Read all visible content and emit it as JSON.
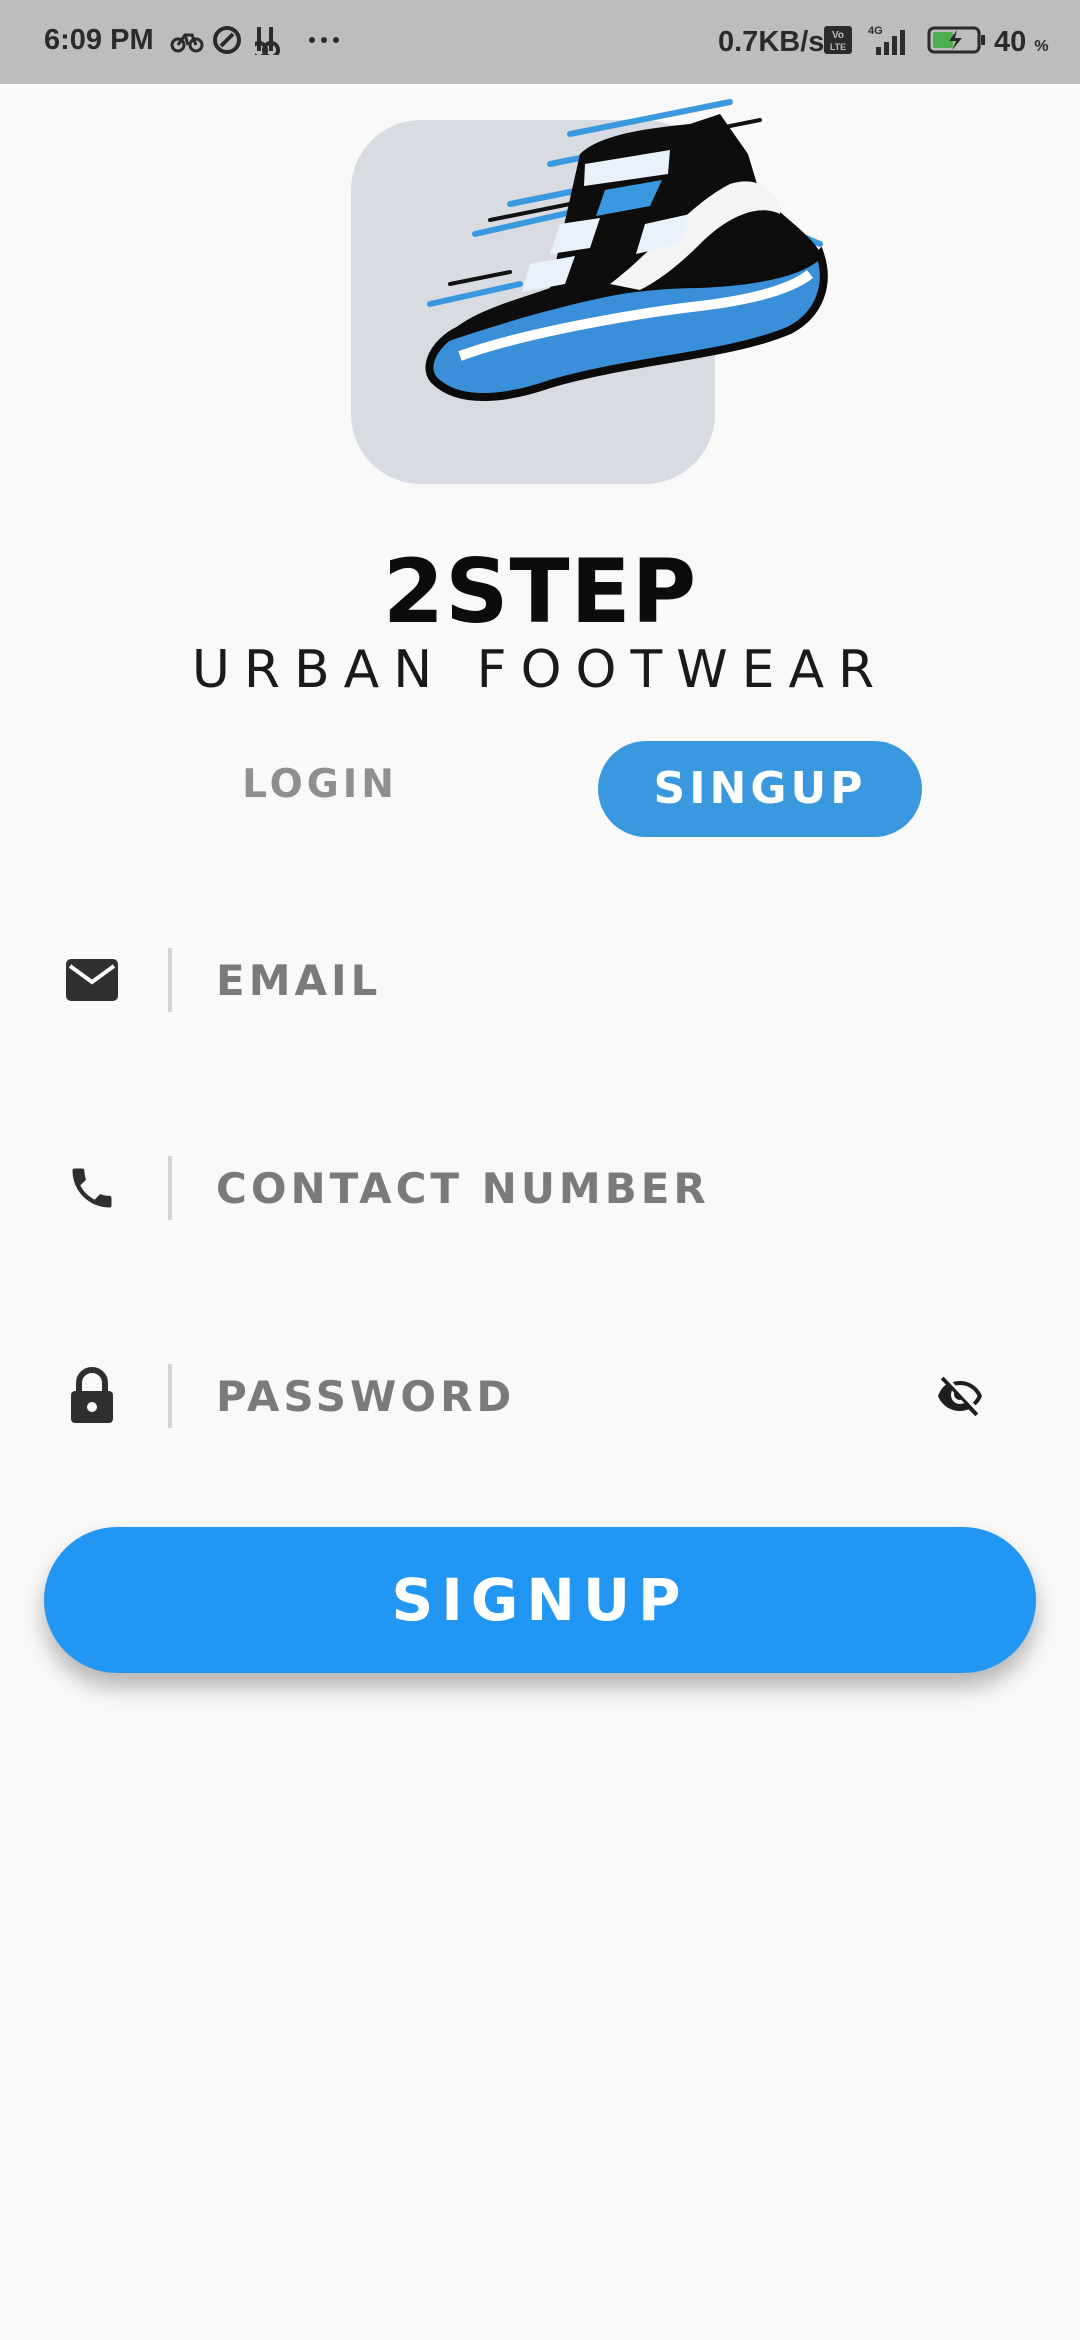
{
  "status_bar": {
    "time": "6:09 PM",
    "network_speed": "0.7KB/s",
    "battery_percent": "40",
    "battery_unit": "%",
    "volte_label": "Vo LTE",
    "network_type": "4G"
  },
  "brand": {
    "title": "2STEP",
    "subtitle": "URBAN FOOTWEAR",
    "logo_icon": "sneaker-logo",
    "accent_color": "#3a99de"
  },
  "tabs": {
    "login_label": "LOGIN",
    "signup_label": "SINGUP",
    "active": "signup"
  },
  "form": {
    "email": {
      "placeholder": "EMAIL",
      "value": "",
      "icon": "mail-icon"
    },
    "contact": {
      "placeholder": "CONTACT NUMBER",
      "value": "",
      "icon": "phone-icon"
    },
    "password": {
      "placeholder": "PASSWORD",
      "value": "",
      "icon": "lock-icon",
      "visibility_icon": "eye-off-icon"
    }
  },
  "submit": {
    "label": "SIGNUP",
    "color": "#2196f3"
  }
}
